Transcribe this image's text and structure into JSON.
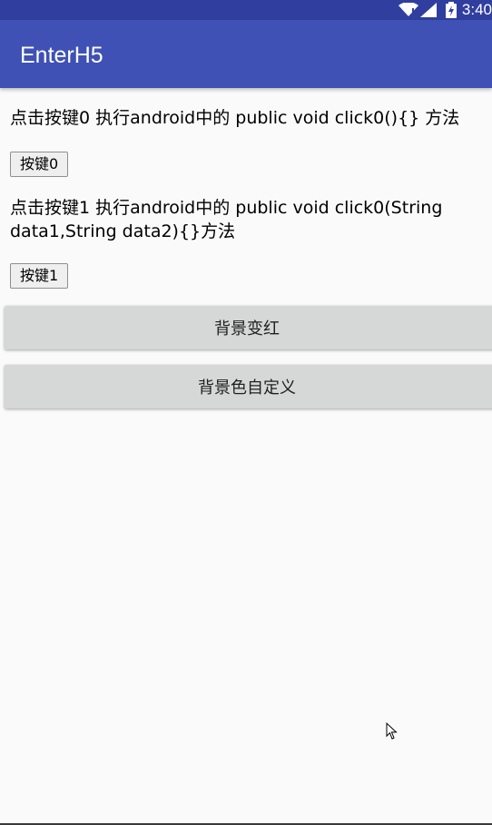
{
  "status_bar": {
    "time": "3:40",
    "icons": [
      "wifi-icon",
      "signal-icon",
      "battery-charging-icon"
    ],
    "color": "#303f9f"
  },
  "app_bar": {
    "title": "EnterH5",
    "color": "#3f51b5"
  },
  "webview": {
    "paragraph0": "点击按键0 执行android中的 public void click0(){} 方法",
    "button0_label": "按键0",
    "paragraph1": "点击按键1 执行android中的 public void click0(String data1,String data2){}方法",
    "button1_label": "按键1"
  },
  "native_buttons": {
    "red_bg_label": "背景变红",
    "custom_bg_label": "背景色自定义"
  }
}
